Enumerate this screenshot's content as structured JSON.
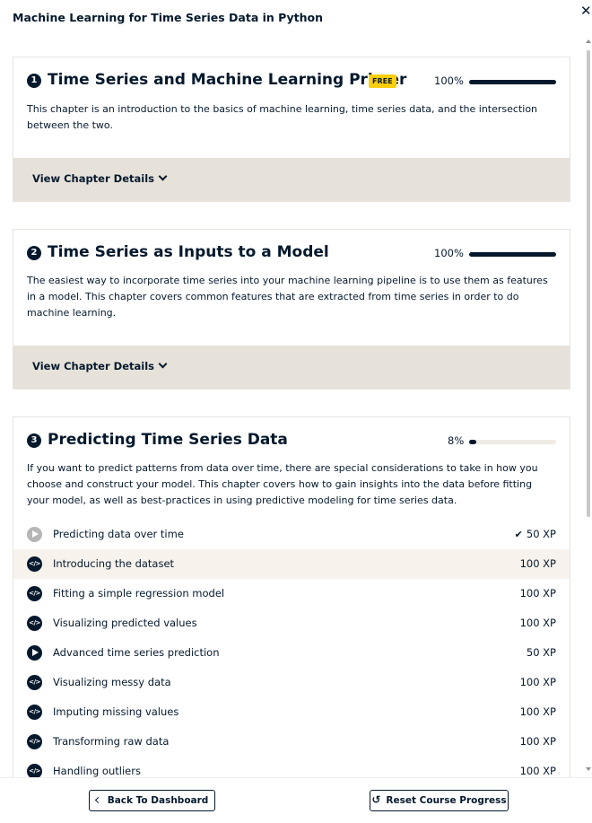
{
  "course_title": "Machine Learning for Time Series Data in Python",
  "close_glyph": "✕",
  "chapters": [
    {
      "number": "1",
      "title": "Time Series and Machine Learning Primer",
      "badge": "FREE",
      "progress_text": "100%",
      "progress": 1.0,
      "desc_lines": [
        "This chapter is an introduction to the basics of machine learning, time series data, and the intersection",
        "between the two."
      ],
      "details_label": "View Chapter Details"
    },
    {
      "number": "2",
      "title": "Time Series as Inputs to a Model",
      "progress_text": "100%",
      "progress": 1.0,
      "desc_lines": [
        "The easiest way to incorporate time series into your machine learning pipeline is to use them as features",
        "in a model. This chapter covers common features that are extracted from time series in order to do",
        "machine learning."
      ],
      "details_label": "View Chapter Details"
    },
    {
      "number": "3",
      "title": "Predicting Time Series Data",
      "progress_text": "8%",
      "progress": 0.08,
      "desc_lines": [
        "If you want to predict patterns from data over time, there are special considerations to take in how you",
        "choose and construct your model. This chapter covers how to gain insights into the data before fitting",
        "your model, as well as best-practices in using predictive modeling for time series data."
      ],
      "exercises": [
        {
          "title": "Predicting data over time",
          "xp": "50 XP",
          "type": "video",
          "completed": true
        },
        {
          "title": "Introducing the dataset",
          "xp": "100 XP",
          "type": "code"
        },
        {
          "title": "Fitting a simple regression model",
          "xp": "100 XP",
          "type": "code"
        },
        {
          "title": "Visualizing predicted values",
          "xp": "100 XP",
          "type": "code"
        },
        {
          "title": "Advanced time series prediction",
          "xp": "50 XP",
          "type": "video"
        },
        {
          "title": "Visualizing messy data",
          "xp": "100 XP",
          "type": "code"
        },
        {
          "title": "Imputing missing values",
          "xp": "100 XP",
          "type": "code"
        },
        {
          "title": "Transforming raw data",
          "xp": "100 XP",
          "type": "code"
        },
        {
          "title": "Handling outliers",
          "xp": "100 XP",
          "type": "code"
        }
      ]
    }
  ],
  "footer": {
    "back_label": "Back To Dashboard",
    "reset_label": "Reset Course Progress"
  },
  "colors": {
    "navy": "#05192d",
    "badge_yellow": "#fcce0d",
    "details_bg": "#e6e2da",
    "highlight_row": "#f7f3ec"
  }
}
